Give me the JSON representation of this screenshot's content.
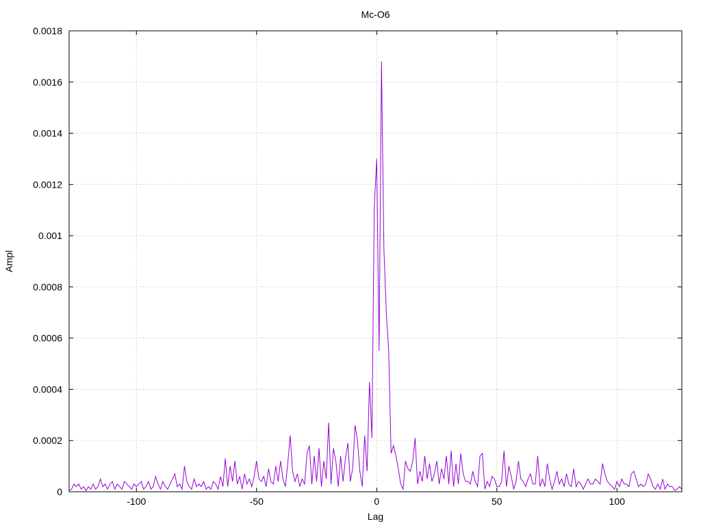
{
  "chart_data": {
    "type": "line",
    "title": "Mc-O6",
    "xlabel": "Lag",
    "ylabel": "Ampl",
    "xlim": [
      -128,
      127
    ],
    "ylim": [
      0,
      0.0018
    ],
    "grid": true,
    "legend": "none",
    "x_ticks": [
      -100,
      -50,
      0,
      50,
      100
    ],
    "x_tick_labels": [
      "-100",
      "-50",
      "0",
      "50",
      "100"
    ],
    "y_ticks": [
      0,
      0.0002,
      0.0004,
      0.0006,
      0.0008,
      0.001,
      0.0012,
      0.0014,
      0.0016,
      0.0018
    ],
    "y_tick_labels": [
      "0",
      "0.0002",
      "0.0004",
      "0.0006",
      "0.0008",
      "0.001",
      "0.0012",
      "0.0014",
      "0.0016",
      "0.0018"
    ],
    "series": [
      {
        "color": "#9400d3",
        "x": [
          -128,
          -127,
          -126,
          -125,
          -124,
          -123,
          -122,
          -121,
          -120,
          -119,
          -118,
          -117,
          -116,
          -115,
          -114,
          -113,
          -112,
          -111,
          -110,
          -109,
          -108,
          -107,
          -106,
          -105,
          -104,
          -103,
          -102,
          -101,
          -100,
          -99,
          -98,
          -97,
          -96,
          -95,
          -94,
          -93,
          -92,
          -91,
          -90,
          -89,
          -88,
          -87,
          -86,
          -85,
          -84,
          -83,
          -82,
          -81,
          -80,
          -79,
          -78,
          -77,
          -76,
          -75,
          -74,
          -73,
          -72,
          -71,
          -70,
          -69,
          -68,
          -67,
          -66,
          -65,
          -64,
          -63,
          -62,
          -61,
          -60,
          -59,
          -58,
          -57,
          -56,
          -55,
          -54,
          -53,
          -52,
          -51,
          -50,
          -49,
          -48,
          -47,
          -46,
          -45,
          -44,
          -43,
          -42,
          -41,
          -40,
          -39,
          -38,
          -37,
          -36,
          -35,
          -34,
          -33,
          -32,
          -31,
          -30,
          -29,
          -28,
          -27,
          -26,
          -25,
          -24,
          -23,
          -22,
          -21,
          -20,
          -19,
          -18,
          -17,
          -16,
          -15,
          -14,
          -13,
          -12,
          -11,
          -10,
          -9,
          -8,
          -7,
          -6,
          -5,
          -4,
          -3,
          -2,
          -1,
          0,
          1,
          2,
          3,
          4,
          5,
          6,
          7,
          8,
          9,
          10,
          11,
          12,
          13,
          14,
          15,
          16,
          17,
          18,
          19,
          20,
          21,
          22,
          23,
          24,
          25,
          26,
          27,
          28,
          29,
          30,
          31,
          32,
          33,
          34,
          35,
          36,
          37,
          38,
          39,
          40,
          41,
          42,
          43,
          44,
          45,
          46,
          47,
          48,
          49,
          50,
          51,
          52,
          53,
          54,
          55,
          56,
          57,
          58,
          59,
          60,
          61,
          62,
          63,
          64,
          65,
          66,
          67,
          68,
          69,
          70,
          71,
          72,
          73,
          74,
          75,
          76,
          77,
          78,
          79,
          80,
          81,
          82,
          83,
          84,
          85,
          86,
          87,
          88,
          89,
          90,
          91,
          92,
          93,
          94,
          95,
          96,
          97,
          98,
          99,
          100,
          101,
          102,
          103,
          104,
          105,
          106,
          107,
          108,
          109,
          110,
          111,
          112,
          113,
          114,
          115,
          116,
          117,
          118,
          119,
          120,
          121,
          122,
          123,
          124,
          125,
          126,
          127
        ],
        "y": [
          5e-06,
          1e-05,
          3e-05,
          2e-05,
          3e-05,
          1e-05,
          2e-05,
          5e-06,
          2e-05,
          1e-05,
          3e-05,
          1e-05,
          2e-05,
          5e-05,
          2e-05,
          3e-05,
          1e-05,
          3e-05,
          4e-05,
          1e-05,
          3e-05,
          2e-05,
          1e-05,
          4e-05,
          3e-05,
          2e-05,
          1e-05,
          3e-05,
          2e-05,
          3e-05,
          4e-05,
          1e-05,
          2e-05,
          4e-05,
          1e-05,
          2e-05,
          6e-05,
          3e-05,
          1e-05,
          4e-05,
          2e-05,
          1e-05,
          3e-05,
          5e-05,
          7e-05,
          2e-05,
          3e-05,
          1e-05,
          0.0001,
          4e-05,
          2e-05,
          1e-05,
          5e-05,
          2e-05,
          3e-05,
          2e-05,
          4e-05,
          1e-05,
          2e-05,
          1e-05,
          4e-05,
          3e-05,
          1e-05,
          6e-05,
          2e-05,
          0.00013,
          2e-05,
          0.0001,
          4e-05,
          0.00012,
          3e-05,
          6e-05,
          1e-05,
          7e-05,
          3e-05,
          5e-05,
          2e-05,
          6e-05,
          0.00012,
          5e-05,
          4e-05,
          6e-05,
          2e-05,
          9e-05,
          4e-05,
          3e-05,
          0.0001,
          4e-05,
          0.00012,
          5e-05,
          2e-05,
          0.00011,
          0.00022,
          8e-05,
          4e-05,
          7e-05,
          2e-05,
          5e-05,
          3e-05,
          0.00015,
          0.00018,
          3e-05,
          0.00014,
          4e-05,
          0.00017,
          2e-05,
          0.00012,
          5e-05,
          0.00027,
          3e-05,
          0.00017,
          0.00012,
          2e-05,
          0.00014,
          4e-05,
          0.00013,
          0.00019,
          4e-05,
          9e-05,
          0.00026,
          0.0002,
          8e-05,
          2e-05,
          0.00022,
          8e-05,
          0.00043,
          0.00021,
          0.00111,
          0.0013,
          0.00055,
          0.00168,
          0.00095,
          0.0007,
          0.00055,
          0.00015,
          0.00018,
          0.00014,
          9e-05,
          3e-05,
          1e-05,
          0.00012,
          9e-05,
          8e-05,
          0.00012,
          0.00021,
          3e-05,
          8e-05,
          4e-05,
          0.00014,
          5e-05,
          0.00011,
          4e-05,
          7e-05,
          0.00012,
          3e-05,
          9e-05,
          5e-05,
          0.00014,
          3e-05,
          0.00016,
          2e-05,
          0.00011,
          3e-05,
          0.00015,
          7e-05,
          4e-05,
          4e-05,
          3e-05,
          8e-05,
          4e-05,
          2e-05,
          0.00014,
          0.00015,
          1e-05,
          4e-05,
          2e-05,
          6e-05,
          5e-05,
          2e-05,
          2e-05,
          4e-05,
          0.00016,
          2e-05,
          0.0001,
          6e-05,
          1e-05,
          4e-05,
          0.00012,
          5e-05,
          4e-05,
          2e-05,
          5e-05,
          7e-05,
          3e-05,
          3e-05,
          0.00014,
          2e-05,
          5e-05,
          2e-05,
          0.00011,
          5e-05,
          1e-05,
          4e-05,
          8e-05,
          3e-05,
          5e-05,
          2e-05,
          7e-05,
          3e-05,
          2e-05,
          9e-05,
          2e-05,
          4e-05,
          3e-05,
          1e-05,
          3e-05,
          5e-05,
          3e-05,
          3e-05,
          5e-05,
          4e-05,
          3e-05,
          0.00011,
          7e-05,
          4e-05,
          3e-05,
          2e-05,
          1e-05,
          4e-05,
          2e-05,
          5e-05,
          3e-05,
          3e-05,
          2e-05,
          7e-05,
          8e-05,
          5e-05,
          2e-05,
          3e-05,
          2e-05,
          3e-05,
          7e-05,
          5e-05,
          2e-05,
          1e-05,
          3e-05,
          1e-05,
          5e-05,
          1e-05,
          3e-05,
          2e-05,
          2e-05,
          5e-06,
          1e-05,
          2e-05,
          1e-05
        ]
      }
    ]
  }
}
